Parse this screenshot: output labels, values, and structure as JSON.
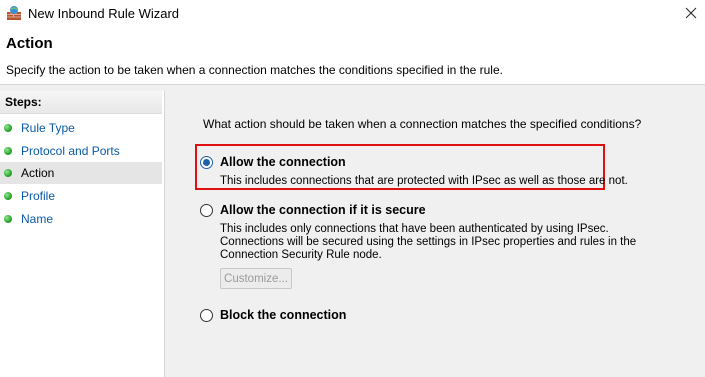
{
  "window": {
    "title": "New Inbound Rule Wizard"
  },
  "header": {
    "title": "Action",
    "description": "Specify the action to be taken when a connection matches the conditions specified in the rule."
  },
  "steps": {
    "heading": "Steps:",
    "items": [
      {
        "label": "Rule Type",
        "active": false
      },
      {
        "label": "Protocol and Ports",
        "active": false
      },
      {
        "label": "Action",
        "active": true
      },
      {
        "label": "Profile",
        "active": false
      },
      {
        "label": "Name",
        "active": false
      }
    ]
  },
  "main": {
    "question": "What action should be taken when a connection matches the specified conditions?",
    "options": [
      {
        "label": "Allow the connection",
        "description": "This includes connections that are protected with IPsec as well as those are not.",
        "selected": true
      },
      {
        "label": "Allow the connection if it is secure",
        "description": "This includes only connections that have been authenticated by using IPsec.  Connections will be secured using the settings in IPsec properties and rules in the Connection Security Rule node.",
        "selected": false
      },
      {
        "label": "Block the connection",
        "description": "",
        "selected": false
      }
    ],
    "customize_label": "Customize..."
  },
  "colors": {
    "highlight": "#e01010",
    "step_link": "#0a5aa6",
    "step_dot": "#1d9a1d",
    "radio_selected": "#1e5fa8"
  },
  "icons": {
    "app": "firewall-icon",
    "close": "close-icon"
  }
}
